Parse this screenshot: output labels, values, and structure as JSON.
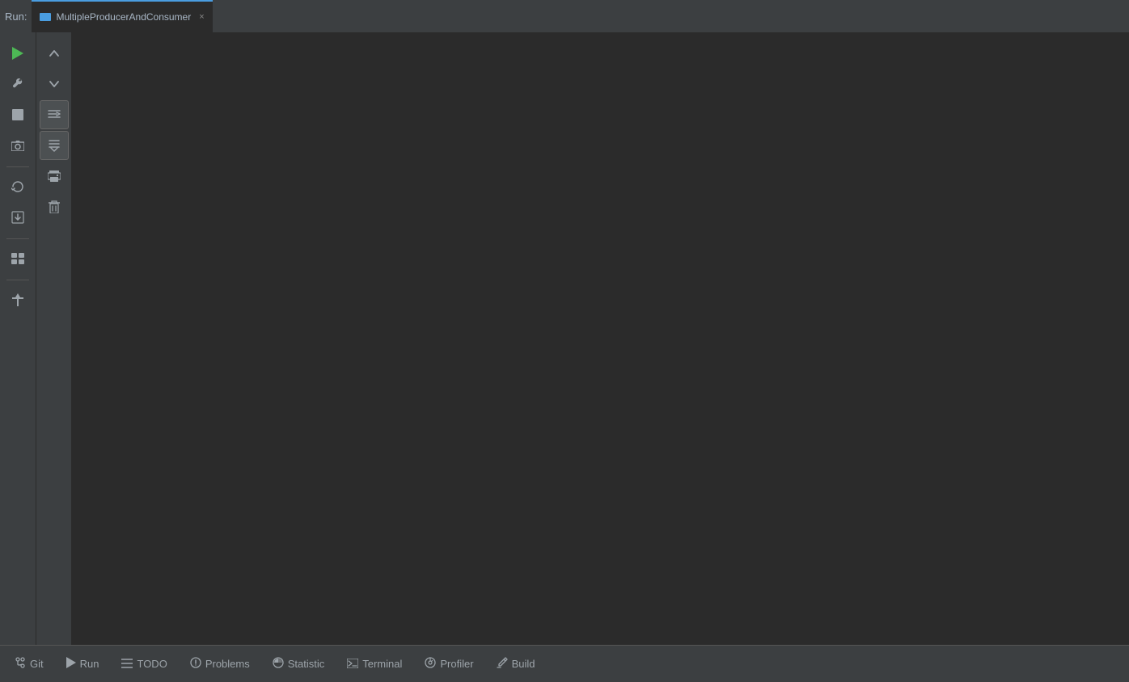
{
  "tabbar": {
    "run_label": "Run:",
    "active_tab": {
      "name": "MultipleProducerAndConsumer",
      "close_label": "×"
    }
  },
  "sidebar": {
    "icons": [
      {
        "name": "play-icon",
        "symbol": "▶",
        "label": "Run"
      },
      {
        "name": "wrench-icon",
        "symbol": "🔧",
        "label": "Settings"
      },
      {
        "name": "stop-icon",
        "symbol": "■",
        "label": "Stop"
      },
      {
        "name": "camera-icon",
        "symbol": "📷",
        "label": "Snapshot"
      },
      {
        "name": "refresh-icon",
        "symbol": "⟳",
        "label": "Reload"
      },
      {
        "name": "import-icon",
        "symbol": "↙",
        "label": "Import"
      },
      {
        "name": "grid-icon",
        "symbol": "⊞",
        "label": "Grid"
      },
      {
        "name": "pin-icon",
        "symbol": "📌",
        "label": "Pin"
      }
    ]
  },
  "inner_toolbar": {
    "icons": [
      {
        "name": "up-arrow-icon",
        "symbol": "↑",
        "label": "Up"
      },
      {
        "name": "down-arrow-icon",
        "symbol": "↓",
        "label": "Down"
      },
      {
        "name": "wrap-text-icon",
        "label": "Wrap",
        "active": true
      },
      {
        "name": "scroll-bottom-icon",
        "label": "Scroll to bottom",
        "active": true
      },
      {
        "name": "print-icon",
        "symbol": "🖨",
        "label": "Print"
      },
      {
        "name": "trash-icon",
        "symbol": "🗑",
        "label": "Clear"
      }
    ]
  },
  "bottom_bar": {
    "tabs": [
      {
        "name": "git-tab",
        "icon": "git",
        "label": "Git"
      },
      {
        "name": "run-tab",
        "icon": "play",
        "label": "Run"
      },
      {
        "name": "todo-tab",
        "icon": "list",
        "label": "TODO"
      },
      {
        "name": "problems-tab",
        "icon": "info",
        "label": "Problems"
      },
      {
        "name": "statistic-tab",
        "icon": "clock",
        "label": "Statistic"
      },
      {
        "name": "terminal-tab",
        "icon": "terminal",
        "label": "Terminal"
      },
      {
        "name": "profiler-tab",
        "icon": "profiler",
        "label": "Profiler"
      },
      {
        "name": "build-tab",
        "icon": "build",
        "label": "Build"
      }
    ]
  }
}
